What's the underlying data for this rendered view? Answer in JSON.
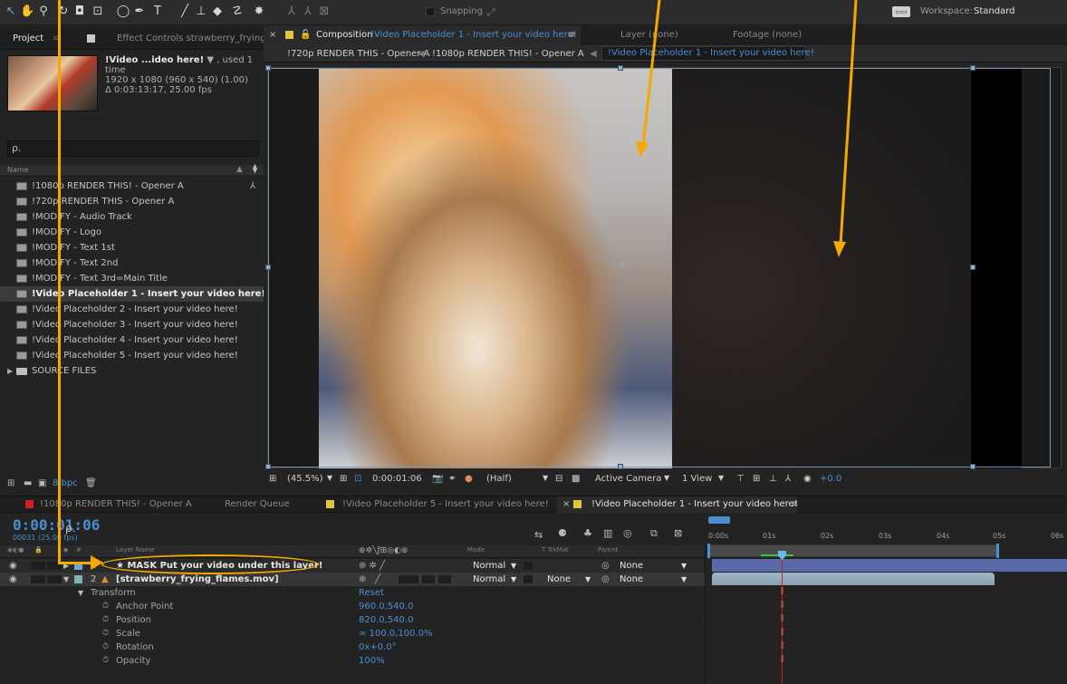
{
  "toolbar": {
    "snapping_label": "Snapping",
    "workspace_label": "Workspace:",
    "workspace_value": "Standard"
  },
  "project": {
    "tab_project": "Project",
    "tab_effect_controls": "Effect Controls strawberry_frying_",
    "selected_name": "!Video ...ideo here!",
    "selected_used": "▼ , used 1 time",
    "selected_res": "1920 x 1080  (960 x 540) (1.00)",
    "selected_dur": "Δ 0:03:13:17, 25.00 fps",
    "search_glyph": "ρ.",
    "header_name": "Name",
    "items": [
      {
        "label": "!1080p RENDER THIS! - Opener A"
      },
      {
        "label": "!720p RENDER THIS - Opener A"
      },
      {
        "label": "!MODIFY - Audio Track"
      },
      {
        "label": "!MODIFY - Logo"
      },
      {
        "label": "!MODIFY - Text 1st"
      },
      {
        "label": "!MODIFY - Text 2nd"
      },
      {
        "label": "!MODIFY - Text 3rd=Main Title"
      },
      {
        "label": "!Video Placeholder 1 - Insert your video here!"
      },
      {
        "label": "!Video Placeholder 2 - Insert your video here!"
      },
      {
        "label": "!Video Placeholder 3 - Insert your video here!"
      },
      {
        "label": "!Video Placeholder 4 - Insert your video here!"
      },
      {
        "label": "!Video Placeholder 5 - Insert your video here!"
      },
      {
        "label": "SOURCE FILES"
      }
    ],
    "bpc": "8 bpc"
  },
  "composition": {
    "tab_label_prefix": "Composition",
    "tab_label_name": "!Video Placeholder 1 - Insert your video here!",
    "tab_layer": "Layer (none)",
    "tab_footage": "Footage (none)",
    "crumbs": [
      "!720p RENDER THIS - Opener A",
      "!1080p RENDER THIS! - Opener A",
      "!Video Placeholder 1 - Insert your video here!"
    ],
    "zoom": "(45.5%)",
    "timecode": "0:00:01:06",
    "resolution": "(Half)",
    "camera": "Active Camera",
    "views": "1 View",
    "exposure": "+0.0"
  },
  "timeline": {
    "tabs": [
      "!1080p RENDER THIS! - Opener A",
      "Render Queue",
      "!Video Placeholder 5 - Insert your video here!",
      "!Video Placeholder 1 - Insert your video here!"
    ],
    "timecode": "0:00:01:06",
    "frame_info": "00031 (25.00 fps)",
    "search_glyph": "ρ.",
    "col_layer_name": "Layer Name",
    "col_mode": "Mode",
    "col_trkmat": "T  TrkMat",
    "col_parent": "Parent",
    "ruler_ticks": [
      "0:00s",
      "01s",
      "02s",
      "03s",
      "04s",
      "05s",
      "06s"
    ],
    "layers": [
      {
        "num": "1",
        "name": "★  MASK Put your video under this layer!",
        "mode": "Normal",
        "trkmat": "",
        "parent": "None"
      },
      {
        "num": "2",
        "name": "[strawberry_frying_flames.mov]",
        "mode": "Normal",
        "trkmat": "None",
        "parent": "None"
      }
    ],
    "transform_label": "Transform",
    "transform_reset": "Reset",
    "properties": [
      {
        "name": "Anchor Point",
        "value": "960.0,540.0"
      },
      {
        "name": "Position",
        "value": "820.0,540.0"
      },
      {
        "name": "Scale",
        "value": "∞ 100.0,100.0%"
      },
      {
        "name": "Rotation",
        "value": "0x+0.0°"
      },
      {
        "name": "Opacity",
        "value": "100%"
      }
    ]
  },
  "colors": {
    "accent_blue": "#4c8fd0",
    "annotation_orange": "#f5a800",
    "playhead_red": "#cc2222"
  }
}
